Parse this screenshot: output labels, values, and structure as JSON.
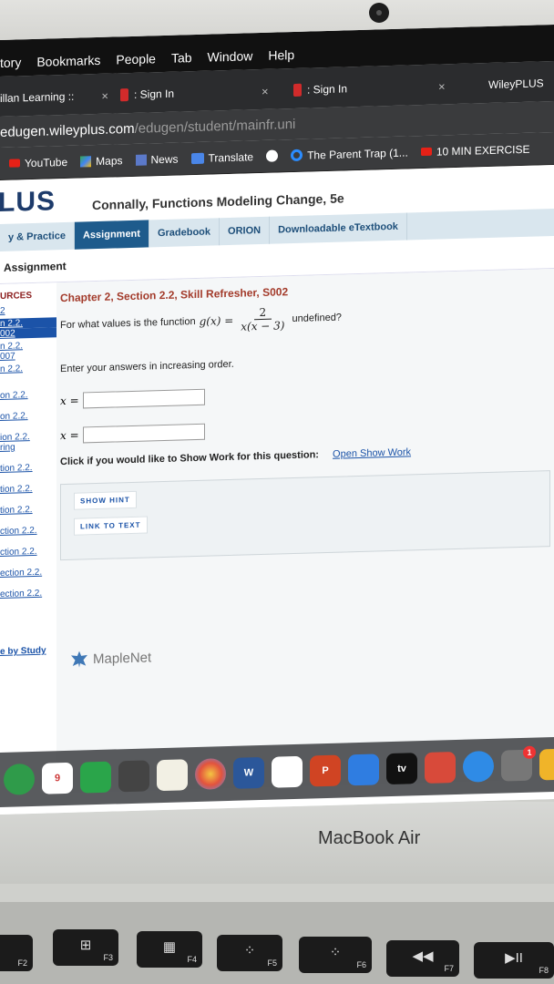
{
  "menubar": {
    "items": [
      "tory",
      "Bookmarks",
      "People",
      "Tab",
      "Window",
      "Help"
    ]
  },
  "tabs": [
    {
      "label": "illan Learning :: ",
      "close": "×"
    },
    {
      "label": ": Sign In",
      "close": "×"
    },
    {
      "label": ": Sign In",
      "close": "×"
    },
    {
      "label": "WileyPLUS"
    }
  ],
  "url": {
    "host": "edugen.wileyplus.com",
    "path": "/edugen/student/mainfr.uni"
  },
  "bookmarks": [
    "YouTube",
    "Maps",
    "News",
    "Translate",
    "The Parent Trap (1...",
    "10 MIN EXERCISE"
  ],
  "page": {
    "brand": "LUS",
    "course": "Connally, Functions Modeling Change, 5e",
    "navtabs": [
      "y & Practice",
      "Assignment",
      "Gradebook",
      "ORION",
      "Downloadable eTextbook"
    ],
    "subhead": "Assignment",
    "sidebar": {
      "header": "URCES",
      "items": [
        "2",
        "n 2.2.",
        "002",
        "n 2.2.",
        "007",
        "n 2.2.",
        "on 2.2.",
        "on 2.2.",
        "ion 2.2.",
        "ring",
        "tion 2.2.",
        "tion 2.2.",
        "tion 2.2.",
        "ction 2.2.",
        "ction 2.2.",
        "ection 2.2.",
        "ection 2.2."
      ],
      "study": "e by Study"
    },
    "question": {
      "title": "Chapter 2, Section 2.2, Skill Refresher, S002",
      "prompt": "For what values is the function",
      "fname": "g(x) =",
      "numerator": "2",
      "denominator": "x(x − 3)",
      "suffix": "undefined?",
      "order": "Enter your answers in increasing order.",
      "var_label": "x =",
      "answer1": "",
      "answer2": "",
      "show_work": "Click if you would like to Show Work for this question:",
      "show_work_link": "Open Show Work",
      "hint_button": "SHOW HINT",
      "link_button": "LINK TO TEXT",
      "powered": "MapleNet"
    }
  },
  "dock": {
    "calendar_day": "9",
    "word": "W",
    "ppt": "P",
    "tv": "tv",
    "notif": "1"
  },
  "laptop": {
    "model": "MacBook Air"
  },
  "keys": [
    {
      "glyph": "",
      "fn": "F2"
    },
    {
      "glyph": "⊞",
      "fn": "F3"
    },
    {
      "glyph": "▦",
      "fn": "F4"
    },
    {
      "glyph": "⁘",
      "fn": "F5"
    },
    {
      "glyph": "⁘",
      "fn": "F6"
    },
    {
      "glyph": "◀◀",
      "fn": "F7"
    },
    {
      "glyph": "▶II",
      "fn": "F8"
    }
  ]
}
